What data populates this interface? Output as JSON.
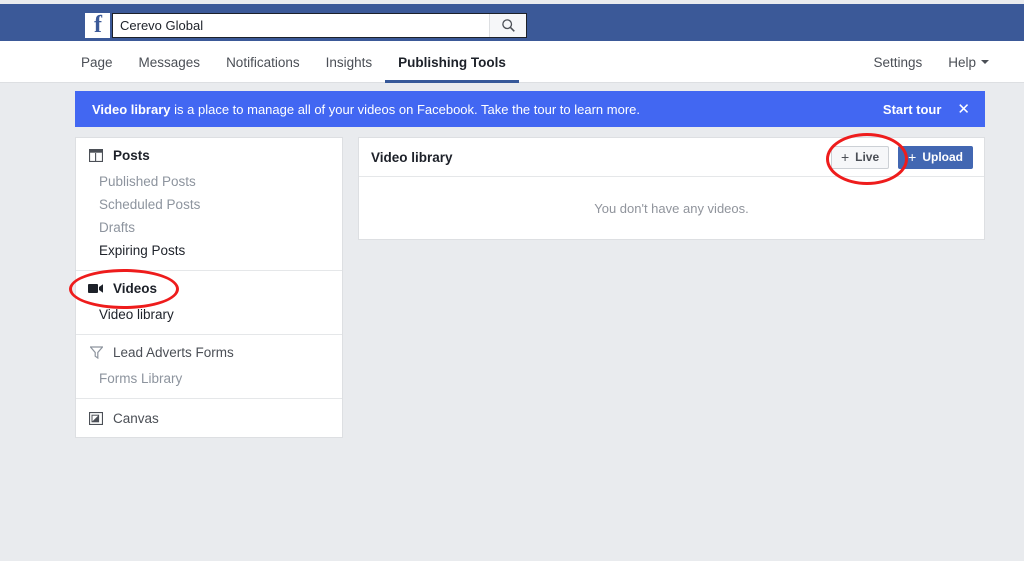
{
  "topbar": {
    "logo_icon": "facebook-logo-icon",
    "search": {
      "value": "Cerevo Global",
      "placeholder": "Search",
      "icon": "search-icon"
    }
  },
  "nav": {
    "left_items": [
      {
        "label": "Page",
        "active": false
      },
      {
        "label": "Messages",
        "active": false
      },
      {
        "label": "Notifications",
        "active": false
      },
      {
        "label": "Insights",
        "active": false
      },
      {
        "label": "Publishing Tools",
        "active": true
      }
    ],
    "right_items": [
      {
        "label": "Settings",
        "caret": false
      },
      {
        "label": "Help",
        "caret": true
      }
    ]
  },
  "banner": {
    "lead": "Video library",
    "rest": " is a place to manage all of your videos on Facebook. Take the tour to learn more.",
    "action_label": "Start tour",
    "close_icon": "close-icon",
    "background_color": "#4267f2"
  },
  "sidebar": {
    "groups": [
      {
        "head": {
          "label": "Posts",
          "icon": "posts-window-icon",
          "style": "bold"
        },
        "items": [
          {
            "label": "Published Posts",
            "style": "muted"
          },
          {
            "label": "Scheduled Posts",
            "style": "muted"
          },
          {
            "label": "Drafts",
            "style": "muted"
          },
          {
            "label": "Expiring Posts",
            "style": "dark"
          }
        ]
      },
      {
        "head": {
          "label": "Videos",
          "icon": "video-camera-icon",
          "style": "bold"
        },
        "items": [
          {
            "label": "Video library",
            "style": "dark"
          }
        ]
      },
      {
        "head": {
          "label": "Lead Adverts Forms",
          "icon": "funnel-icon",
          "style": "plain"
        },
        "items": [
          {
            "label": "Forms Library",
            "style": "muted"
          }
        ]
      },
      {
        "head": {
          "label": "Canvas",
          "icon": "canvas-square-icon",
          "style": "plain"
        },
        "items": []
      }
    ]
  },
  "panel": {
    "title": "Video library",
    "live_button": {
      "label": "Live",
      "plus": "+"
    },
    "upload_button": {
      "label": "Upload",
      "plus": "+"
    },
    "empty_message": "You don't have any videos."
  },
  "annotations": {
    "color": "#ee1c1c",
    "shapes": [
      {
        "name": "videos-highlight",
        "target": "sidebar Videos item"
      },
      {
        "name": "live-button-highlight",
        "target": "+ Live button"
      }
    ]
  }
}
